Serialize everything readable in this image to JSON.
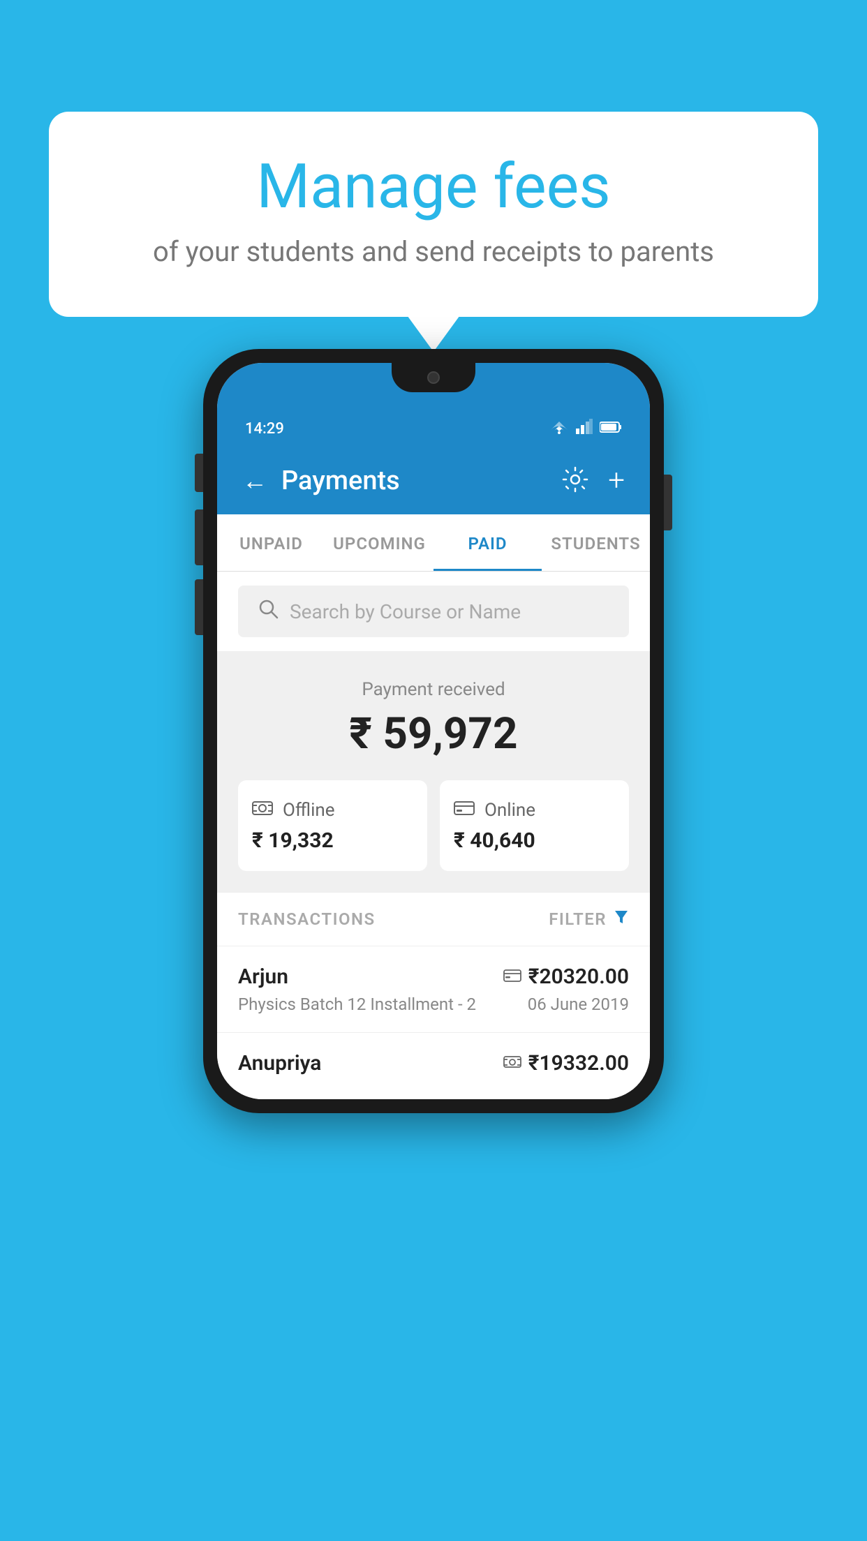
{
  "background_color": "#29B6E8",
  "speech_bubble": {
    "title": "Manage fees",
    "subtitle": "of your students and send receipts to parents"
  },
  "status_bar": {
    "time": "14:29",
    "wifi": "▾",
    "signal": "▴",
    "battery": "▮"
  },
  "app_bar": {
    "back_label": "←",
    "title": "Payments",
    "gear_label": "⚙",
    "plus_label": "+"
  },
  "tabs": [
    {
      "label": "UNPAID",
      "active": false
    },
    {
      "label": "UPCOMING",
      "active": false
    },
    {
      "label": "PAID",
      "active": true
    },
    {
      "label": "STUDENTS",
      "active": false
    }
  ],
  "search": {
    "placeholder": "Search by Course or Name"
  },
  "payment_summary": {
    "label": "Payment received",
    "amount": "₹ 59,972",
    "offline_label": "Offline",
    "offline_amount": "₹ 19,332",
    "online_label": "Online",
    "online_amount": "₹ 40,640"
  },
  "transactions_section": {
    "label": "TRANSACTIONS",
    "filter_label": "FILTER"
  },
  "transactions": [
    {
      "name": "Arjun",
      "course": "Physics Batch 12 Installment - 2",
      "amount": "₹20320.00",
      "date": "06 June 2019",
      "payment_type": "card"
    },
    {
      "name": "Anupriya",
      "course": "",
      "amount": "₹19332.00",
      "date": "",
      "payment_type": "cash"
    }
  ]
}
